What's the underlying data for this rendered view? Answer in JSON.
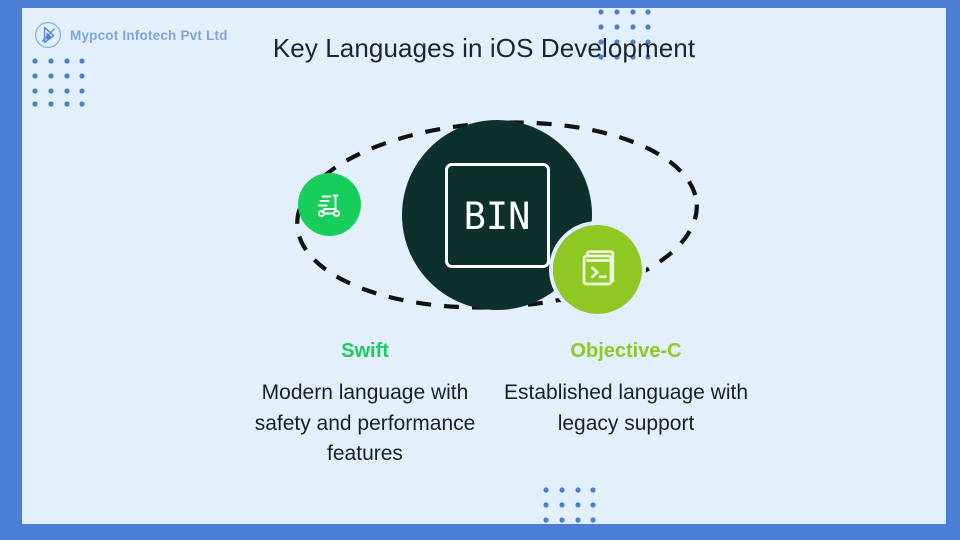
{
  "slide": {
    "title": "Key Languages in iOS Development",
    "border_color": "#4a7fd4",
    "background_color": "#e3f0fb"
  },
  "brand": {
    "name": "Mypcot Infotech Pvt Ltd",
    "logo_icon": "circled-play-mark-icon",
    "text_color": "#7ba5dd"
  },
  "diagram": {
    "core": {
      "label": "BIN",
      "icon": "bin-box-icon",
      "color": "#0d302d"
    },
    "orbit": {
      "style": "dashed-ellipse",
      "color": "#111111"
    },
    "nodes": [
      {
        "icon": "scooter-icon",
        "color": "#17ce5c",
        "name": "swift-node"
      },
      {
        "icon": "terminal-console-icon",
        "color": "#8fc823",
        "name": "objective-c-node"
      }
    ]
  },
  "columns": [
    {
      "heading": "Swift",
      "heading_color": "#17ce5c",
      "body": "Modern language with safety and performance features"
    },
    {
      "heading": "Objective-C",
      "heading_color": "#8fc823",
      "body": "Established language with legacy support"
    }
  ],
  "decor": {
    "dot_color": "#4a7fd4",
    "grids": [
      {
        "name": "dot-grid-top-left"
      },
      {
        "name": "dot-grid-top-center"
      },
      {
        "name": "dot-grid-bottom-center"
      }
    ]
  }
}
